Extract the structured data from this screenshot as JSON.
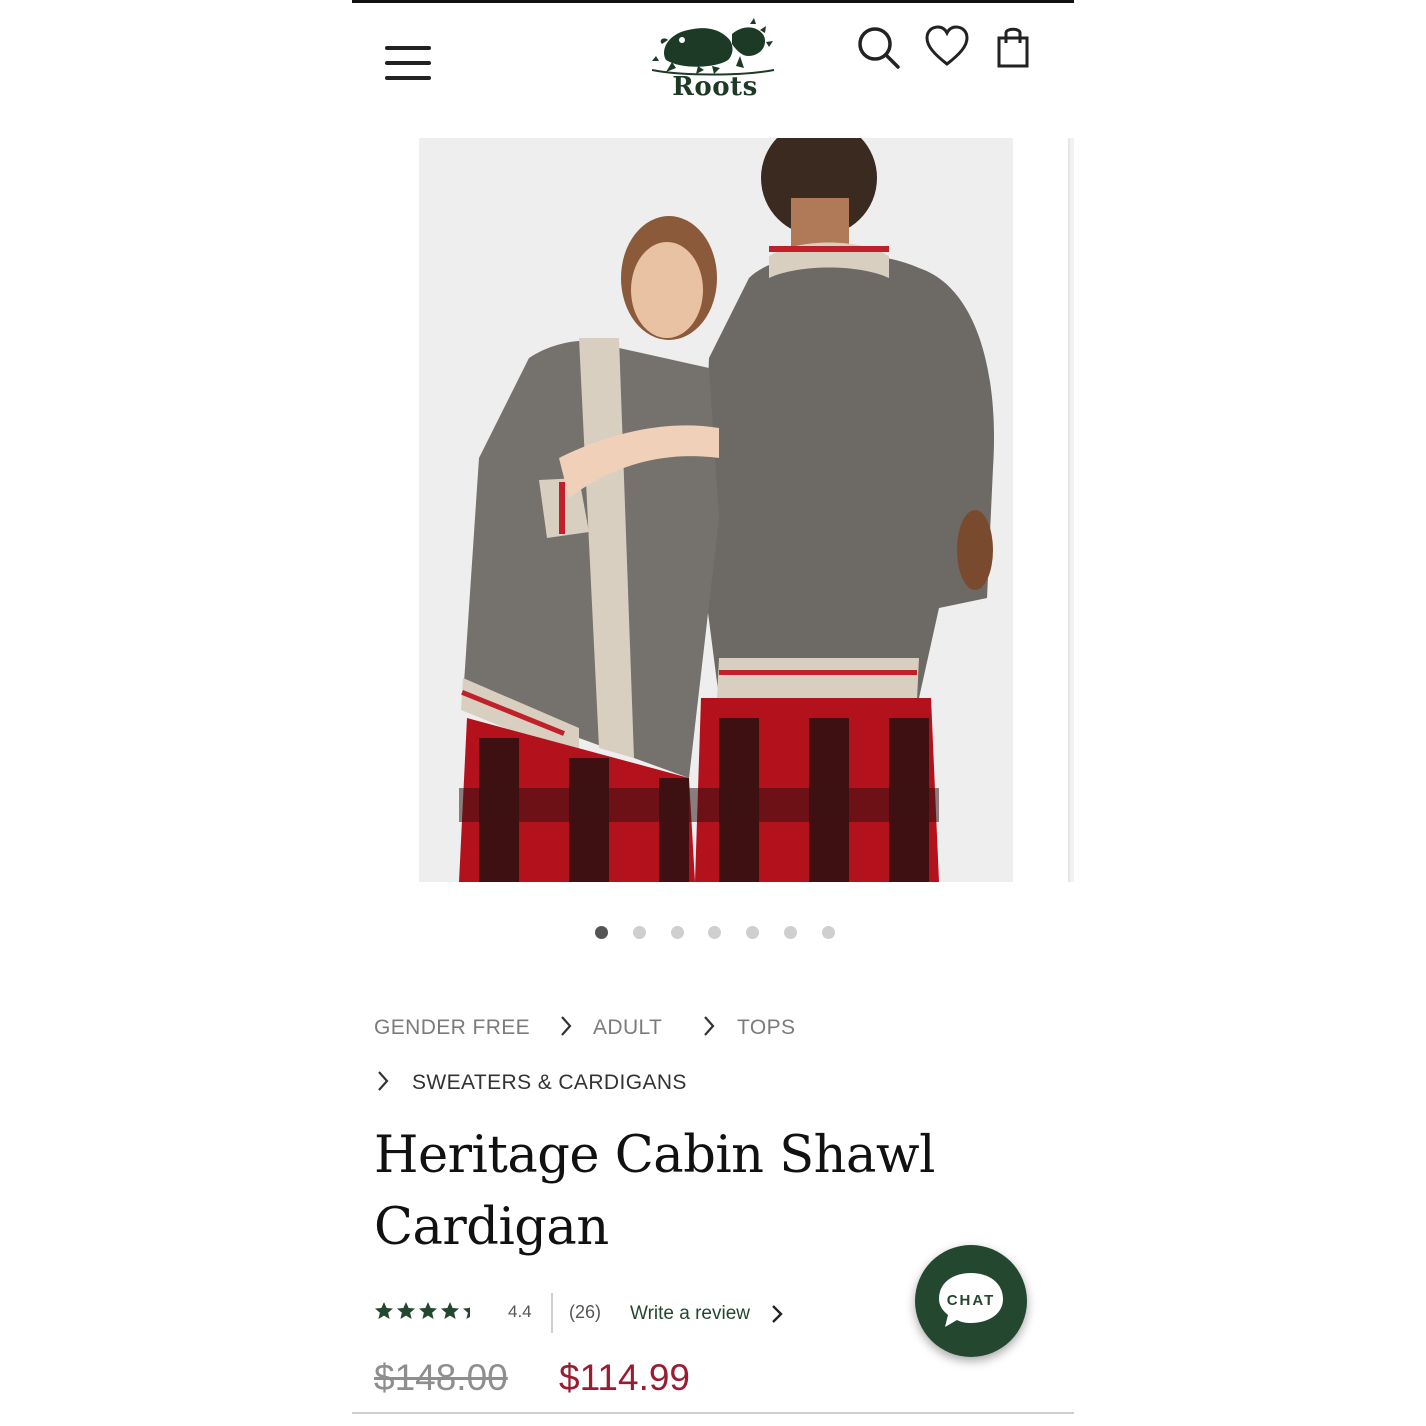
{
  "header": {
    "brand": "Roots",
    "menu_icon": "hamburger-menu-icon",
    "search_icon": "search-icon",
    "wishlist_icon": "heart-icon",
    "cart_icon": "shopping-bag-icon"
  },
  "gallery": {
    "image_icon": "product-photo",
    "slide_count": 7,
    "active_slide": 1
  },
  "breadcrumb": {
    "items": [
      "GENDER FREE",
      "ADULT",
      "TOPS",
      "SWEATERS & CARDIGANS"
    ]
  },
  "product": {
    "title_line1": "Heritage Cabin Shawl",
    "title_line2": "Cardigan",
    "rating": "4.4",
    "rating_fraction": 0.88,
    "review_count": "(26)",
    "write_review": "Write a review",
    "price_original": "$148.00",
    "price_sale": "$114.99"
  },
  "chat": {
    "label": "CHAT"
  },
  "colors": {
    "brand_green": "#23472f",
    "sale_red": "#9b1c31",
    "text_gray": "#7b7b7b"
  }
}
